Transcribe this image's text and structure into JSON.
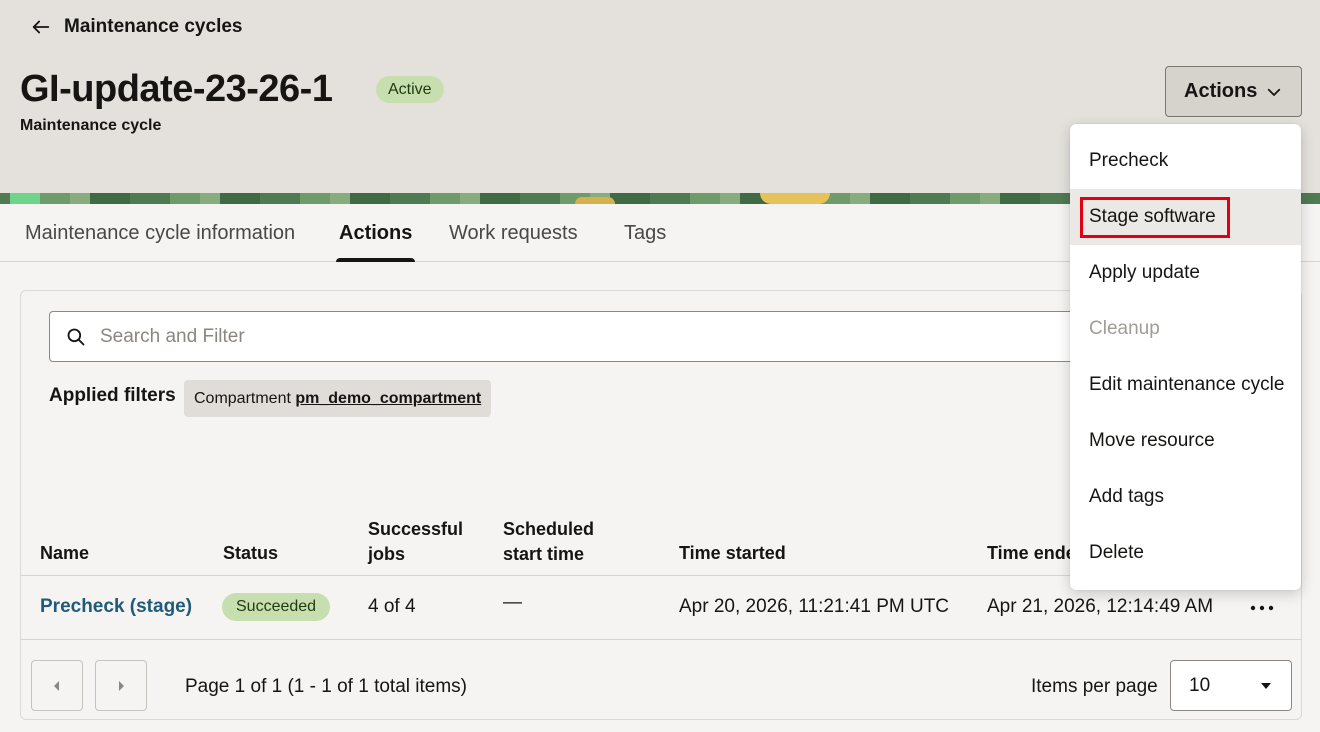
{
  "breadcrumb": {
    "label": "Maintenance cycles"
  },
  "header": {
    "title": "GI-update-23-26-1",
    "status": "Active",
    "subtitle": "Maintenance cycle",
    "actions_label": "Actions"
  },
  "tabs": [
    {
      "label": "Maintenance cycle information",
      "active": false
    },
    {
      "label": "Actions",
      "active": true
    },
    {
      "label": "Work requests",
      "active": false
    },
    {
      "label": "Tags",
      "active": false
    }
  ],
  "search": {
    "placeholder": "Search and Filter",
    "value": ""
  },
  "filters": {
    "label": "Applied filters",
    "chip_key": "Compartment",
    "chip_value": "pm_demo_compartment"
  },
  "table": {
    "columns": [
      "Name",
      "Status",
      "Successful jobs",
      "Scheduled start time",
      "Time started",
      "Time ended"
    ],
    "column_lines": [
      [
        "Name"
      ],
      [
        "Status"
      ],
      [
        "Successful",
        "jobs"
      ],
      [
        "Scheduled",
        "start time"
      ],
      [
        "Time started"
      ],
      [
        "Time ended"
      ]
    ],
    "rows": [
      {
        "name": "Precheck (stage)",
        "status": "Succeeded",
        "successful_jobs": "4 of 4",
        "scheduled_start": "—",
        "time_started": "Apr 20, 2026, 11:21:41 PM UTC",
        "time_ended": "Apr 21, 2026, 12:14:49 AM"
      }
    ]
  },
  "pagination": {
    "info": "Page 1 of 1 (1 - 1 of 1 total items)",
    "items_per_page_label": "Items per page",
    "items_per_page_value": "10"
  },
  "dropdown": {
    "items": [
      {
        "label": "Precheck",
        "disabled": false
      },
      {
        "label": "Stage software",
        "disabled": false,
        "hovered": true
      },
      {
        "label": "Apply update",
        "disabled": false
      },
      {
        "label": "Cleanup",
        "disabled": true
      },
      {
        "label": "Edit maintenance cycle",
        "disabled": false
      },
      {
        "label": "Move resource",
        "disabled": false
      },
      {
        "label": "Add tags",
        "disabled": false
      },
      {
        "label": "Delete",
        "disabled": false
      }
    ]
  },
  "colors": {
    "header_bg": "#e4e1dc",
    "status_active": "#c7dfae",
    "link": "#1f5b78",
    "highlight": "#e00010"
  }
}
